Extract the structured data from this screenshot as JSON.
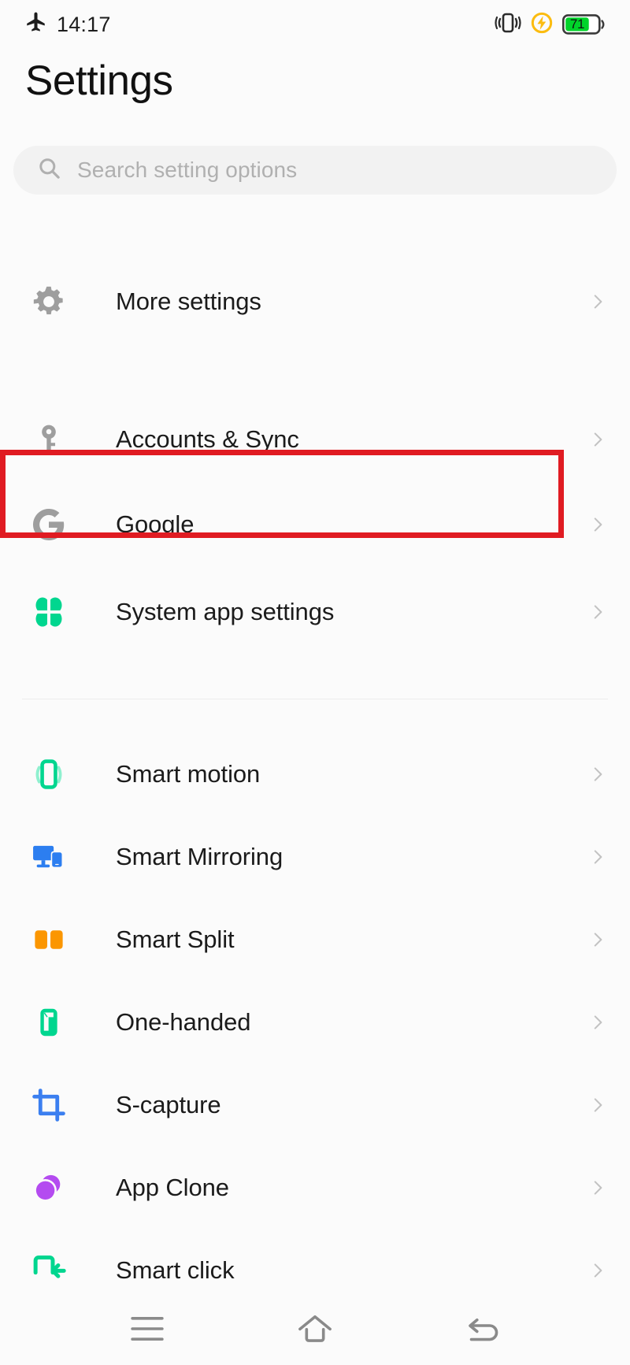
{
  "status_bar": {
    "airplane_icon": "airplane-mode-icon",
    "time": "14:17",
    "vibrate_icon": "vibrate-icon",
    "charging_icon": "charging-bolt-icon",
    "battery_level": "71",
    "battery_color": "#00d42a"
  },
  "header": {
    "title": "Settings"
  },
  "search": {
    "placeholder": "Search setting options",
    "icon": "search-icon"
  },
  "highlight": {
    "color": "#e01b22",
    "target": "Google"
  },
  "list": {
    "groups": [
      {
        "items": [
          {
            "label": "More settings",
            "icon": "gear-icon",
            "icon_color": "#9e9e9e",
            "chevron": "chevron-right-icon"
          },
          {
            "label": "Accounts & Sync",
            "icon": "key-icon",
            "icon_color": "#9e9e9e",
            "chevron": "chevron-right-icon"
          },
          {
            "label": "Google",
            "icon": "google-g-icon",
            "icon_color": "#9e9e9e",
            "chevron": "chevron-right-icon",
            "highlighted": true
          },
          {
            "label": "System app settings",
            "icon": "clover-icon",
            "icon_color": "#00d68f",
            "chevron": "chevron-right-icon"
          }
        ]
      },
      {
        "items": [
          {
            "label": "Smart motion",
            "icon": "smart-motion-phone-icon",
            "icon_color": "#00d68f",
            "chevron": "chevron-right-icon"
          },
          {
            "label": "Smart Mirroring",
            "icon": "monitor-phone-icon",
            "icon_color": "#2c7ef0",
            "chevron": "chevron-right-icon"
          },
          {
            "label": "Smart Split",
            "icon": "split-screen-icon",
            "icon_color": "#fb9600",
            "chevron": "chevron-right-icon"
          },
          {
            "label": "One-handed",
            "icon": "one-handed-icon",
            "icon_color": "#00d68f",
            "chevron": "chevron-right-icon"
          },
          {
            "label": "S-capture",
            "icon": "crop-capture-icon",
            "icon_color": "#3b7ff0",
            "chevron": "chevron-right-icon"
          },
          {
            "label": "App Clone",
            "icon": "app-clone-circles-icon",
            "icon_color": "#b44bf0",
            "chevron": "chevron-right-icon"
          },
          {
            "label": "Smart click",
            "icon": "smart-click-icon",
            "icon_color": "#00d68f",
            "chevron": "chevron-right-icon",
            "clipped": true
          }
        ]
      }
    ]
  },
  "navbar": {
    "buttons": [
      {
        "name": "menu-icon",
        "label": "Menu"
      },
      {
        "name": "home-icon",
        "label": "Home"
      },
      {
        "name": "back-icon",
        "label": "Back"
      }
    ]
  }
}
